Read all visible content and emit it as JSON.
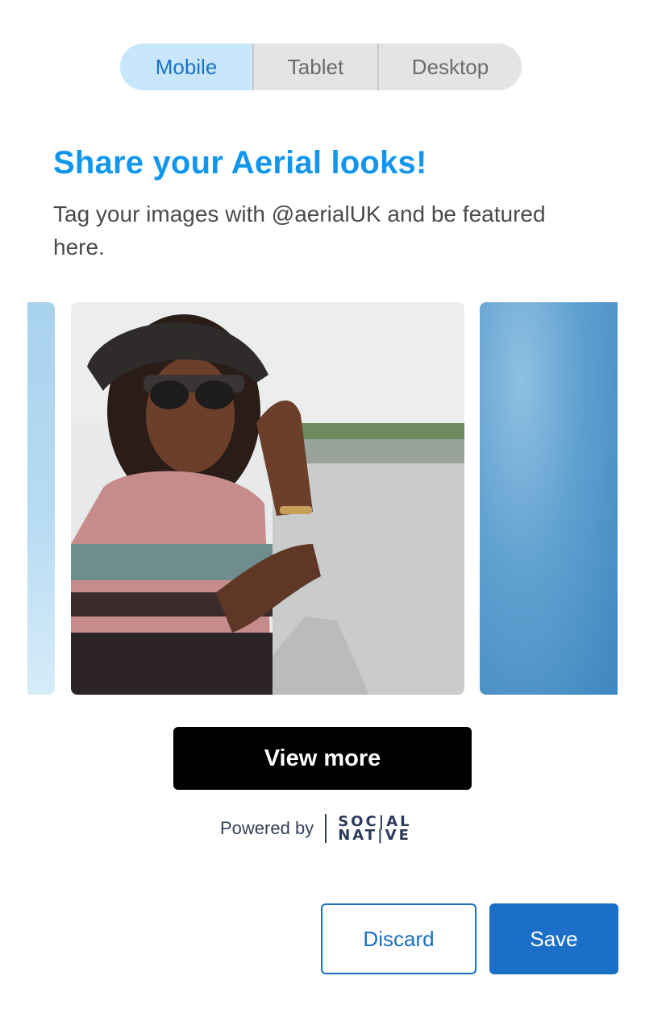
{
  "device_toggle": {
    "options": [
      "Mobile",
      "Tablet",
      "Desktop"
    ],
    "selected": "Mobile"
  },
  "widget": {
    "title": "Share your Aerial looks!",
    "subtitle": "Tag your images with @aerialUK and be featured here.",
    "view_more_label": "View more",
    "powered_by_label": "Powered by",
    "brand_line1": "SOC|AL",
    "brand_line2": "NAT|VE"
  },
  "carousel": {
    "images": [
      {
        "alt": "sky-photo"
      },
      {
        "alt": "woman-in-hat-and-sunglasses-photo"
      },
      {
        "alt": "blue-wall-photo"
      }
    ]
  },
  "actions": {
    "discard_label": "Discard",
    "save_label": "Save"
  },
  "colors": {
    "accent": "#1296ec",
    "primary_button": "#1b6fc7",
    "toggle_active_bg": "#c9e7fb"
  }
}
